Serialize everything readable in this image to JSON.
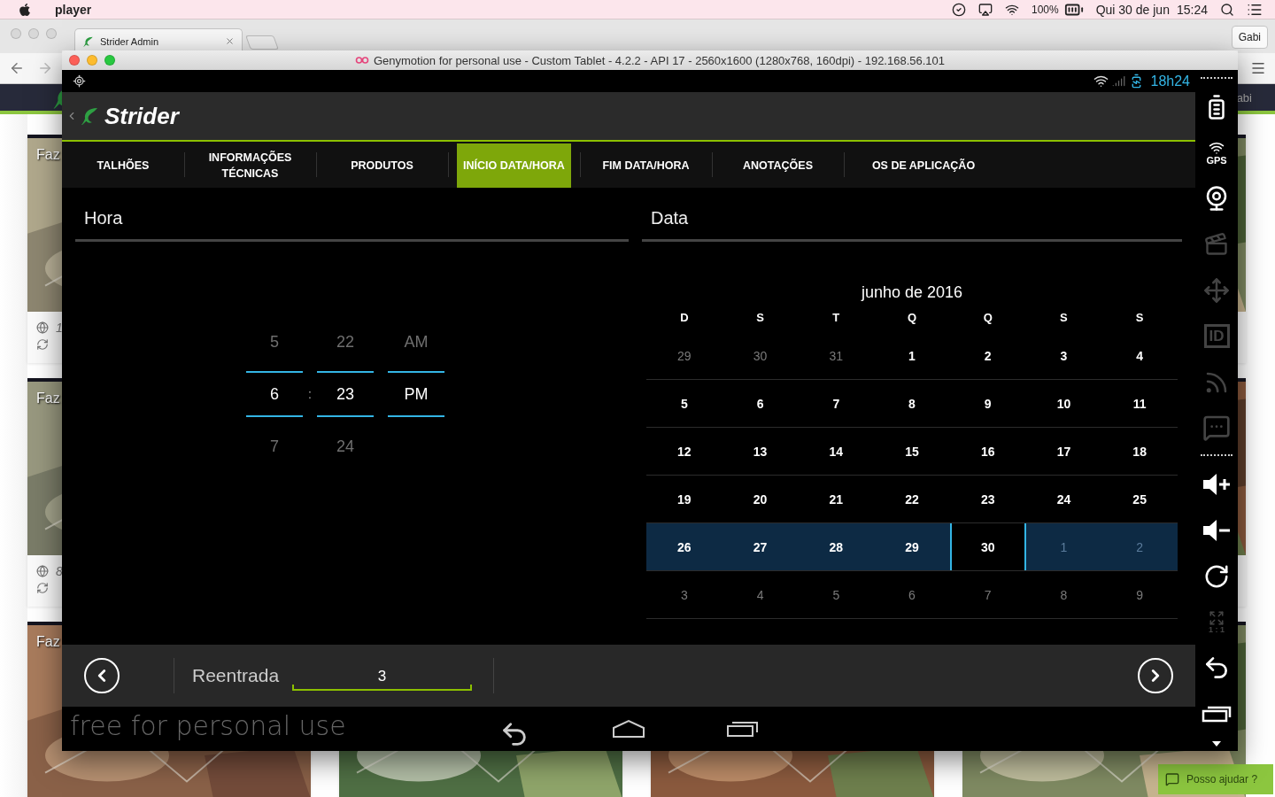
{
  "menubar": {
    "app": "player",
    "battery": "100%",
    "date": "Qui 30 de jun",
    "time": "15:24"
  },
  "browser": {
    "tabs": [
      {
        "title": "Strider Admin",
        "selected": true
      }
    ],
    "profile": "Gabi",
    "page": {
      "header_text": "abi",
      "help_button": "Posso ajudar ?",
      "left_cards": [
        {
          "kind": "picture",
          "title": "Faz",
          "area": "1"
        },
        {
          "kind": "picture",
          "title": "Faz",
          "area": "8"
        }
      ],
      "right_cards": [
        {
          "kind": "picture"
        },
        {
          "kind": "picture"
        }
      ],
      "bottom_cards": [
        {
          "kind": "picture",
          "title": "Faz"
        },
        {
          "kind": "picture"
        },
        {
          "kind": "picture"
        },
        {
          "kind": "picture"
        }
      ]
    }
  },
  "emulator": {
    "title": "Genymotion for personal use - Custom Tablet - 4.2.2 - API 17 - 2560x1600 (1280x768, 160dpi) - 192.168.56.101",
    "status_time": "18h24",
    "app_name": "Strider",
    "tabs": [
      {
        "label": "TALHÕES",
        "selected": false
      },
      {
        "label": "INFORMAÇÕES TÉCNICAS",
        "selected": false
      },
      {
        "label": "PRODUTOS",
        "selected": false
      },
      {
        "label": "INÍCIO DATA/HORA",
        "selected": true
      },
      {
        "label": "FIM DATA/HORA",
        "selected": false
      },
      {
        "label": "ANOTAÇÕES",
        "selected": false
      },
      {
        "label": "OS DE APLICAÇÃO",
        "selected": false
      }
    ],
    "time_panel": {
      "title": "Hora",
      "columns": [
        {
          "above": "5",
          "value": "6",
          "below": "7",
          "separator_after": ":"
        },
        {
          "above": "22",
          "value": "23",
          "below": "24"
        },
        {
          "above": "AM",
          "value": "PM"
        }
      ]
    },
    "date_panel": {
      "title": "Data",
      "month": "junho de 2016",
      "weekdays": [
        "D",
        "S",
        "T",
        "Q",
        "Q",
        "S",
        "S"
      ],
      "weeks": [
        {
          "highlighted": false,
          "days": [
            {
              "day": "29",
              "other_month": true,
              "selected": false
            },
            {
              "day": "30",
              "other_month": true,
              "selected": false
            },
            {
              "day": "31",
              "other_month": true,
              "selected": false
            },
            {
              "day": "1",
              "other_month": false,
              "selected": false
            },
            {
              "day": "2",
              "other_month": false,
              "selected": false
            },
            {
              "day": "3",
              "other_month": false,
              "selected": false
            },
            {
              "day": "4",
              "other_month": false,
              "selected": false
            }
          ]
        },
        {
          "highlighted": false,
          "days": [
            {
              "day": "5",
              "other_month": false,
              "selected": false
            },
            {
              "day": "6",
              "other_month": false,
              "selected": false
            },
            {
              "day": "7",
              "other_month": false,
              "selected": false
            },
            {
              "day": "8",
              "other_month": false,
              "selected": false
            },
            {
              "day": "9",
              "other_month": false,
              "selected": false
            },
            {
              "day": "10",
              "other_month": false,
              "selected": false
            },
            {
              "day": "11",
              "other_month": false,
              "selected": false
            }
          ]
        },
        {
          "highlighted": false,
          "days": [
            {
              "day": "12",
              "other_month": false,
              "selected": false
            },
            {
              "day": "13",
              "other_month": false,
              "selected": false
            },
            {
              "day": "14",
              "other_month": false,
              "selected": false
            },
            {
              "day": "15",
              "other_month": false,
              "selected": false
            },
            {
              "day": "16",
              "other_month": false,
              "selected": false
            },
            {
              "day": "17",
              "other_month": false,
              "selected": false
            },
            {
              "day": "18",
              "other_month": false,
              "selected": false
            }
          ]
        },
        {
          "highlighted": false,
          "days": [
            {
              "day": "19",
              "other_month": false,
              "selected": false
            },
            {
              "day": "20",
              "other_month": false,
              "selected": false
            },
            {
              "day": "21",
              "other_month": false,
              "selected": false
            },
            {
              "day": "22",
              "other_month": false,
              "selected": false
            },
            {
              "day": "23",
              "other_month": false,
              "selected": false
            },
            {
              "day": "24",
              "other_month": false,
              "selected": false
            },
            {
              "day": "25",
              "other_month": false,
              "selected": false
            }
          ]
        },
        {
          "highlighted": true,
          "days": [
            {
              "day": "26",
              "other_month": false,
              "selected": false
            },
            {
              "day": "27",
              "other_month": false,
              "selected": false
            },
            {
              "day": "28",
              "other_month": false,
              "selected": false
            },
            {
              "day": "29",
              "other_month": false,
              "selected": false
            },
            {
              "day": "30",
              "other_month": false,
              "selected": true
            },
            {
              "day": "1",
              "other_month": true,
              "selected": false
            },
            {
              "day": "2",
              "other_month": true,
              "selected": false
            }
          ]
        },
        {
          "highlighted": false,
          "days": [
            {
              "day": "3",
              "other_month": true,
              "selected": false
            },
            {
              "day": "4",
              "other_month": true,
              "selected": false
            },
            {
              "day": "5",
              "other_month": true,
              "selected": false
            },
            {
              "day": "6",
              "other_month": true,
              "selected": false
            },
            {
              "day": "7",
              "other_month": true,
              "selected": false
            },
            {
              "day": "8",
              "other_month": true,
              "selected": false
            },
            {
              "day": "9",
              "other_month": true,
              "selected": false
            }
          ]
        }
      ]
    },
    "footer": {
      "field_label": "Reentrada",
      "field_value": "3"
    },
    "watermark": "free for personal use",
    "toolbar": [
      {
        "kind": "separator"
      },
      {
        "kind": "battery",
        "enabled": true
      },
      {
        "kind": "gps",
        "label": "GPS",
        "enabled": true
      },
      {
        "kind": "webcam",
        "enabled": true
      },
      {
        "kind": "capture",
        "enabled": false
      },
      {
        "kind": "dpad",
        "enabled": false
      },
      {
        "kind": "id",
        "label": "ID",
        "enabled": false
      },
      {
        "kind": "rss",
        "enabled": false
      },
      {
        "kind": "sms",
        "enabled": false
      },
      {
        "kind": "separator"
      },
      {
        "kind": "volume_up",
        "enabled": true
      },
      {
        "kind": "volume_down",
        "enabled": true
      },
      {
        "kind": "rotate",
        "enabled": true
      },
      {
        "kind": "scale",
        "label": "1 : 1",
        "enabled": false
      },
      {
        "kind": "back",
        "enabled": true
      },
      {
        "kind": "recents",
        "enabled": true
      },
      {
        "kind": "more",
        "enabled": true
      }
    ]
  }
}
